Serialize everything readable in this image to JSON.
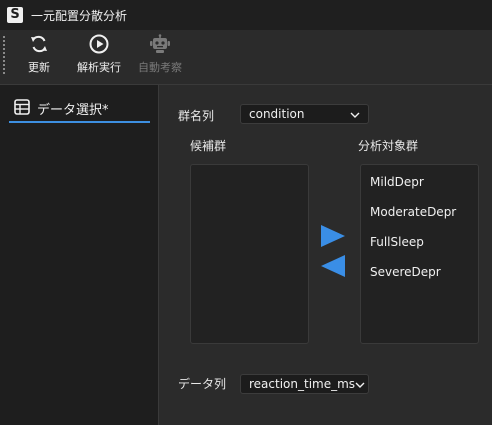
{
  "window": {
    "title": "一元配置分散分析",
    "logo": "S"
  },
  "toolbar": {
    "items": [
      {
        "label": "更新",
        "icon": "refresh-icon",
        "enabled": true
      },
      {
        "label": "解析実行",
        "icon": "play-circle-icon",
        "enabled": true
      },
      {
        "label": "自動考察",
        "icon": "robot-icon",
        "enabled": false
      }
    ]
  },
  "sidebar": {
    "tabs": [
      {
        "label": "データ選択*",
        "icon": "table-icon",
        "active": true
      }
    ]
  },
  "main": {
    "group_column_label": "群名列",
    "group_column_value": "condition",
    "candidates_label": "候補群",
    "candidates": [],
    "targets_label": "分析対象群",
    "targets": [
      "MildDepr",
      "ModerateDepr",
      "FullSleep",
      "SevereDepr"
    ],
    "data_column_label": "データ列",
    "data_column_value": "reaction_time_ms"
  },
  "colors": {
    "accent": "#3d8fe0",
    "arrow": "#3a8ee6"
  }
}
